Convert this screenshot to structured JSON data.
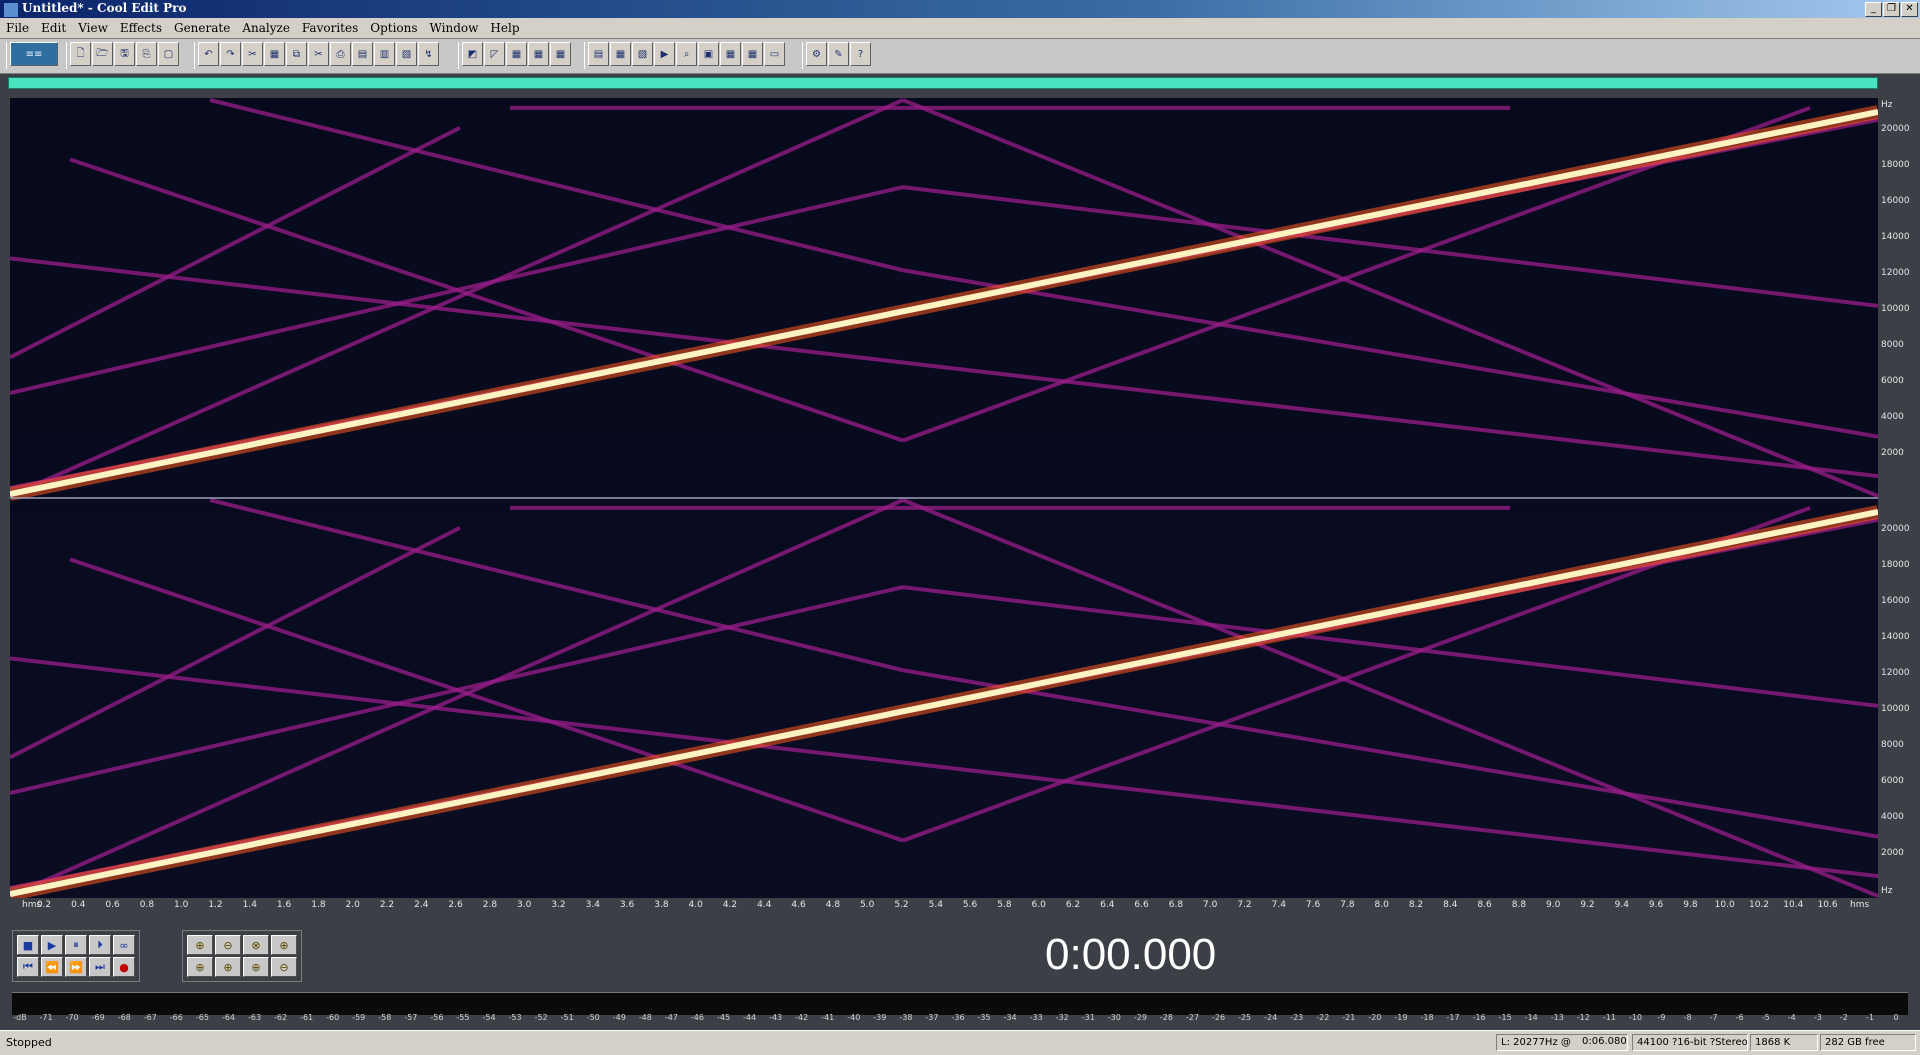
{
  "window": {
    "title": "Untitled* - Cool Edit Pro",
    "controls": [
      "_",
      "❐",
      "✕"
    ]
  },
  "menu": [
    "File",
    "Edit",
    "View",
    "Effects",
    "Generate",
    "Analyze",
    "Favorites",
    "Options",
    "Window",
    "Help"
  ],
  "toolbar": {
    "mode_button": "≡≡",
    "groups": [
      [
        "🗋",
        "🗁",
        "🖫",
        "⎘",
        "▢"
      ],
      [
        "↶",
        "↷",
        "✂",
        "▦",
        "⧉",
        "✂",
        "⎙",
        "▤",
        "▥",
        "▧",
        "↯"
      ],
      [
        "◩",
        "◸",
        "▦",
        "▦",
        "▦"
      ],
      [
        "▤",
        "▦",
        "▧",
        "▶",
        "⌕",
        "▣",
        "▦",
        "▦",
        "▭"
      ],
      [
        "⚙",
        "✎",
        "?"
      ]
    ]
  },
  "spectral": {
    "y_axis_unit": "Hz",
    "y_ticks": [
      "20000",
      "18000",
      "16000",
      "14000",
      "12000",
      "10000",
      "8000",
      "6000",
      "4000",
      "2000"
    ],
    "x_unit_left": "hms",
    "x_unit_right": "hms",
    "x_ticks": [
      "0.2",
      "0.4",
      "0.6",
      "0.8",
      "1.0",
      "1.2",
      "1.4",
      "1.6",
      "1.8",
      "2.0",
      "2.2",
      "2.4",
      "2.6",
      "2.8",
      "3.0",
      "3.2",
      "3.4",
      "3.6",
      "3.8",
      "4.0",
      "4.2",
      "4.4",
      "4.6",
      "4.8",
      "5.0",
      "5.2",
      "5.4",
      "5.6",
      "5.8",
      "6.0",
      "6.2",
      "6.4",
      "6.6",
      "6.8",
      "7.0",
      "7.2",
      "7.4",
      "7.6",
      "7.8",
      "8.0",
      "8.2",
      "8.4",
      "8.6",
      "8.8",
      "9.0",
      "9.2",
      "9.4",
      "9.6",
      "9.8",
      "10.0",
      "10.2",
      "10.4",
      "10.6"
    ]
  },
  "transport": {
    "buttons": [
      "■",
      "▶",
      "⏸",
      "⏵",
      "∞",
      "⏮",
      "⏪",
      "⏩",
      "⏭",
      "●"
    ],
    "zoom_buttons": [
      "⊕",
      "⊖",
      "⊗",
      "⊕",
      "⊕",
      "⊕",
      "⊕",
      "⊖"
    ],
    "time": "0:00.000"
  },
  "meter_scale": [
    "-dB",
    "-71",
    "-70",
    "-69",
    "-68",
    "-67",
    "-66",
    "-65",
    "-64",
    "-63",
    "-62",
    "-61",
    "-60",
    "-59",
    "-58",
    "-57",
    "-56",
    "-55",
    "-54",
    "-53",
    "-52",
    "-51",
    "-50",
    "-49",
    "-48",
    "-47",
    "-46",
    "-45",
    "-44",
    "-43",
    "-42",
    "-41",
    "-40",
    "-39",
    "-38",
    "-37",
    "-36",
    "-35",
    "-34",
    "-33",
    "-32",
    "-31",
    "-30",
    "-29",
    "-28",
    "-27",
    "-26",
    "-25",
    "-24",
    "-23",
    "-22",
    "-21",
    "-20",
    "-19",
    "-18",
    "-17",
    "-16",
    "-15",
    "-14",
    "-13",
    "-12",
    "-11",
    "-10",
    "-9",
    "-8",
    "-7",
    "-6",
    "-5",
    "-4",
    "-3",
    "-2",
    "-1",
    "0"
  ],
  "status": {
    "state": "Stopped",
    "cursor_freq": "L: 20277Hz @",
    "cursor_time": "0:06.080",
    "format": "44100 ?16-bit ?Stereo",
    "size": "1868 K",
    "free": "282 GB free"
  },
  "colors": {
    "spectrum_bg": "#050818",
    "sweep_hot": "#fff3c4",
    "sweep_glow": "#ff5a1e",
    "harmonic": "#9a1e8a",
    "overview": "#49e3c0"
  }
}
